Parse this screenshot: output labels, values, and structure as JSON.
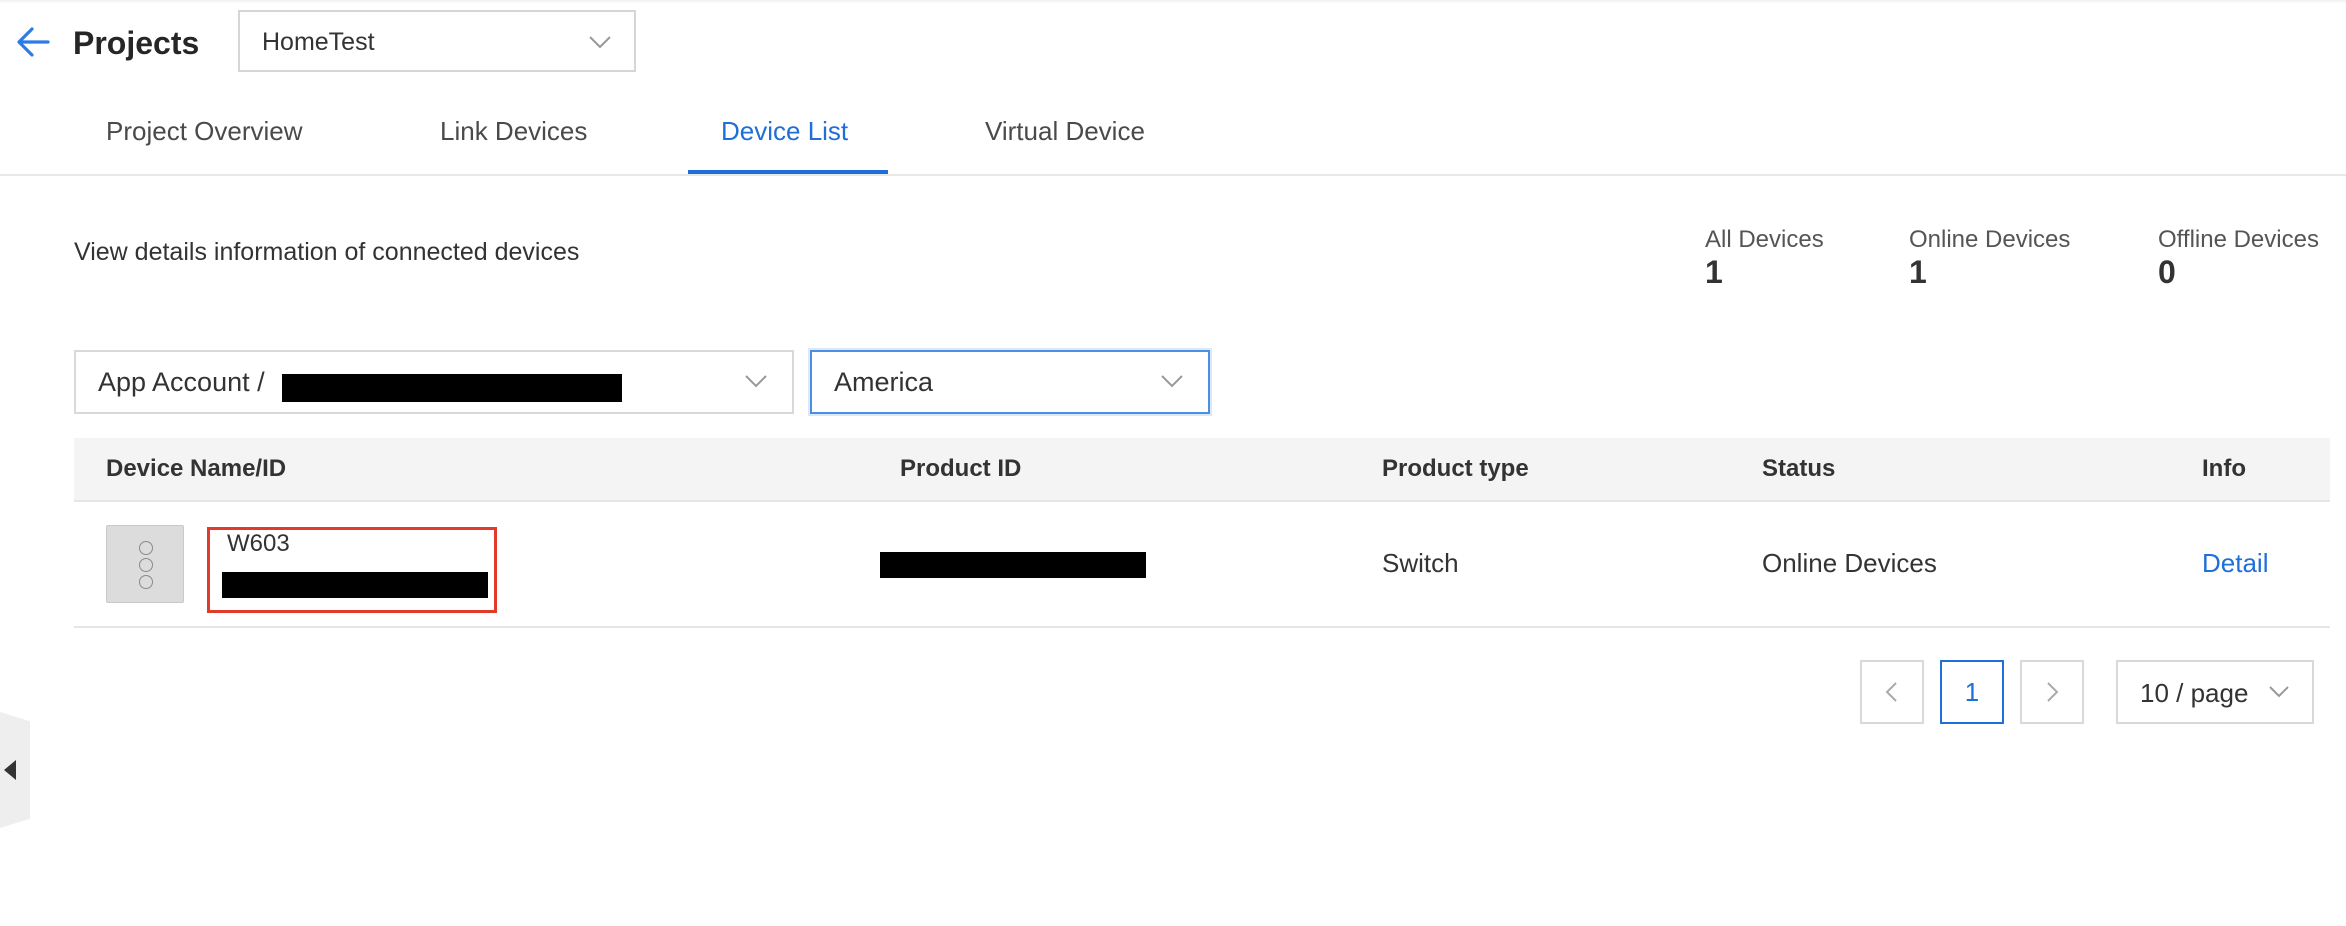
{
  "header": {
    "title": "Projects",
    "project_select": {
      "value": "HomeTest"
    }
  },
  "tabs": [
    {
      "label": "Project Overview",
      "active": false
    },
    {
      "label": "Link Devices",
      "active": false
    },
    {
      "label": "Device List",
      "active": true
    },
    {
      "label": "Virtual Device",
      "active": false
    }
  ],
  "summary": {
    "description": "View details information of connected devices",
    "stats": [
      {
        "label": "All Devices",
        "value": "1"
      },
      {
        "label": "Online Devices",
        "value": "1"
      },
      {
        "label": "Offline Devices",
        "value": "0"
      }
    ]
  },
  "filters": {
    "account": {
      "value": "App Account / ",
      "redacted": true
    },
    "region": {
      "value": "America"
    }
  },
  "table": {
    "columns": [
      "Device Name/ID",
      "Product ID",
      "Product type",
      "Status",
      "Info"
    ],
    "rows": [
      {
        "device_name": "W603",
        "device_id_redacted": true,
        "product_id_redacted": true,
        "product_type": "Switch",
        "status": "Online Devices",
        "info_link": "Detail"
      }
    ]
  },
  "pagination": {
    "current_page": "1",
    "page_size": "10 / page"
  },
  "colors": {
    "accent": "#1e6fd9",
    "highlight": "#e03b2a",
    "header_bg": "#f4f4f4"
  },
  "icons": [
    "arrow-left-icon",
    "chevron-down-icon",
    "chevron-left-icon",
    "chevron-right-icon",
    "caret-left-icon"
  ]
}
